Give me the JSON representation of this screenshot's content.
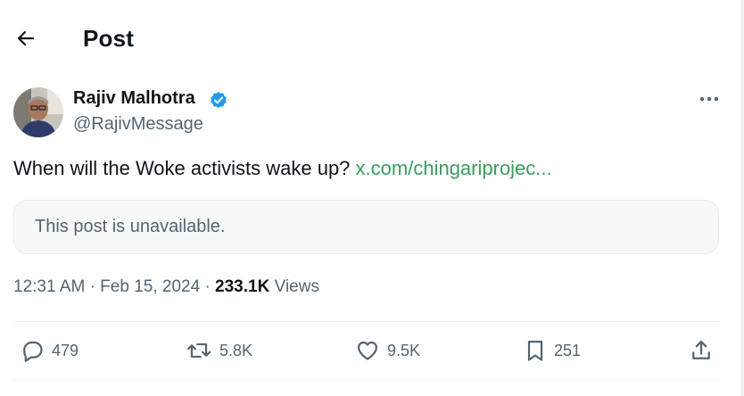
{
  "header": {
    "title": "Post"
  },
  "author": {
    "name": "Rajiv Malhotra",
    "handle": "@RajivMessage",
    "verified": true
  },
  "post": {
    "text": "When will the Woke activists wake up?",
    "link_text": "x.com/chingariprojec...",
    "quoted": {
      "unavailable_text": "This post is unavailable."
    }
  },
  "meta": {
    "time": "12:31 AM",
    "separator": "·",
    "date": "Feb 15, 2024",
    "views_count": "233.1K",
    "views_label": "Views"
  },
  "actions": {
    "replies": "479",
    "reposts": "5.8K",
    "likes": "9.5K",
    "bookmarks": "251"
  },
  "colors": {
    "link": "#3a9c5e",
    "verified": "#1d9bf0",
    "muted": "#536471",
    "text": "#0f1419"
  },
  "icons": [
    "back-arrow-icon",
    "verified-badge-icon",
    "more-icon",
    "reply-icon",
    "repost-icon",
    "like-icon",
    "bookmark-icon",
    "share-icon"
  ]
}
